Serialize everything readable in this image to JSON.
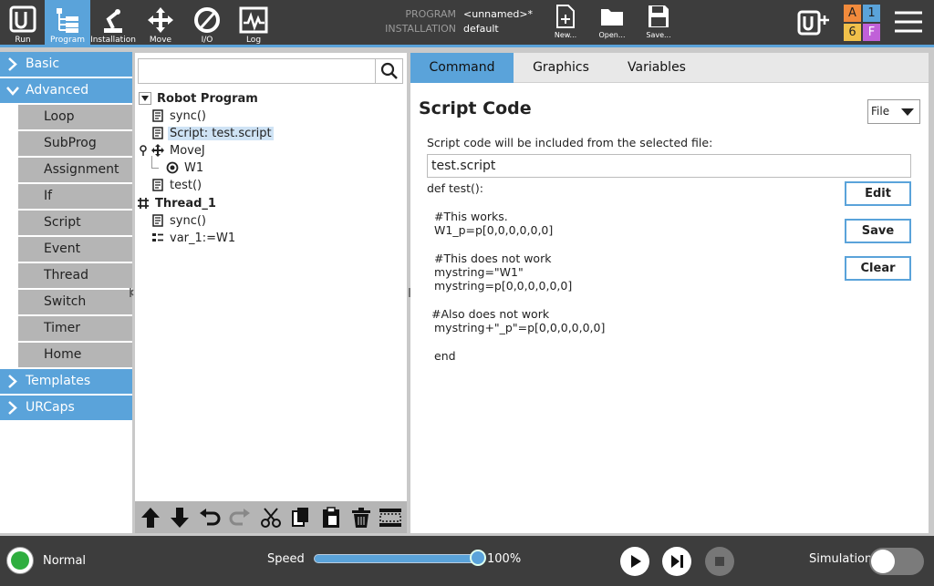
{
  "topbar": {
    "tabs": [
      {
        "label": "Run"
      },
      {
        "label": "Program"
      },
      {
        "label": "Installation"
      },
      {
        "label": "Move"
      },
      {
        "label": "I/O"
      },
      {
        "label": "Log"
      }
    ],
    "program_key": "PROGRAM",
    "program_value": "<unnamed>*",
    "installation_key": "INSTALLATION",
    "installation_value": "default",
    "file_buttons": [
      {
        "label": "New..."
      },
      {
        "label": "Open..."
      },
      {
        "label": "Save..."
      }
    ],
    "badges": {
      "a": "A",
      "one": "1",
      "six": "6",
      "f": "F"
    },
    "colors": {
      "bar": "#3d3d3d",
      "accent": "#5aa3da",
      "badge_a": "#f08a3c",
      "badge_1": "#5aa3da",
      "badge_6": "#f0c04a",
      "badge_f": "#c060d8"
    }
  },
  "leftnav": {
    "categories": {
      "basic": "Basic",
      "advanced": "Advanced",
      "templates": "Templates",
      "urcaps": "URCaps"
    },
    "advanced_items": [
      "Loop",
      "SubProg",
      "Assignment",
      "If",
      "Script",
      "Event",
      "Thread",
      "Switch",
      "Timer",
      "Home"
    ]
  },
  "tree": {
    "search_placeholder": "",
    "nodes": [
      {
        "label": "Robot Program"
      },
      {
        "label": "sync()"
      },
      {
        "label": "Script: test.script"
      },
      {
        "label": "MoveJ"
      },
      {
        "label": "W1"
      },
      {
        "label": "test()"
      },
      {
        "label": "Thread_1"
      },
      {
        "label": "sync()"
      },
      {
        "label": "var_1:=W1"
      }
    ]
  },
  "editor": {
    "tabs": {
      "command": "Command",
      "graphics": "Graphics",
      "variables": "Variables"
    },
    "title": "Script Code",
    "source_select": "File",
    "description": "Script code will be included from the selected file:",
    "filename": "test.script",
    "code_lines": [
      "def test():",
      "#This works.",
      "W1_p=p[0,0,0,0,0,0]",
      "#This does not work",
      "mystring=\"W1\"",
      "mystring=p[0,0,0,0,0,0]",
      "#Also does not work",
      "mystring+\"_p\"=p[0,0,0,0,0,0]",
      "end"
    ],
    "buttons": {
      "edit": "Edit",
      "save": "Save",
      "clear": "Clear"
    }
  },
  "bottombar": {
    "status": "Normal",
    "speed_label": "Speed",
    "speed_value": "100%",
    "speed_fraction": 1.0,
    "simulation_label": "Simulation"
  }
}
